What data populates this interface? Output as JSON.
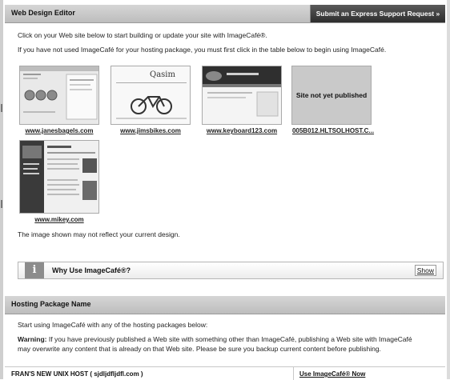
{
  "editor": {
    "title": "Web Design Editor",
    "express_button": "Submit an Express Support Request »",
    "intro_line1": "Click on your Web site below to start building or update your site with ImageCafé®.",
    "intro_line2": "If you have not used ImageCafé for your hosting package,  you must first click in the table below to begin using ImageCafé.",
    "sites": [
      {
        "label": "www.janesbagels.com"
      },
      {
        "label": "www.jimsbikes.com",
        "logo_text": "Qasim"
      },
      {
        "label": "www.keyboard123.com"
      },
      {
        "label": "005B012.HLTSOLHOST.C...",
        "placeholder": "Site not yet published"
      },
      {
        "label": "www.mikey.com"
      }
    ],
    "note": "The image shown may not reflect your current design."
  },
  "why_box": {
    "label": "Why Use ImageCafé®?",
    "show_label": "Show"
  },
  "hosting": {
    "title": "Hosting Package Name",
    "start_text": "Start using ImageCafé with any of the hosting packages below:",
    "warning_label": "Warning:",
    "warning_line1": " If you have previously published a Web site with something other than ImageCafé, publishing a Web site with ImageCafé",
    "warning_line2": "may overwrite any content that is already on that Web site. Please be sure you backup current content before publishing.",
    "row": {
      "host": "FRAN'S NEW UNIX HOST ( sjdljdfljdfl.com )",
      "action": "Use ImageCafé® Now"
    }
  }
}
